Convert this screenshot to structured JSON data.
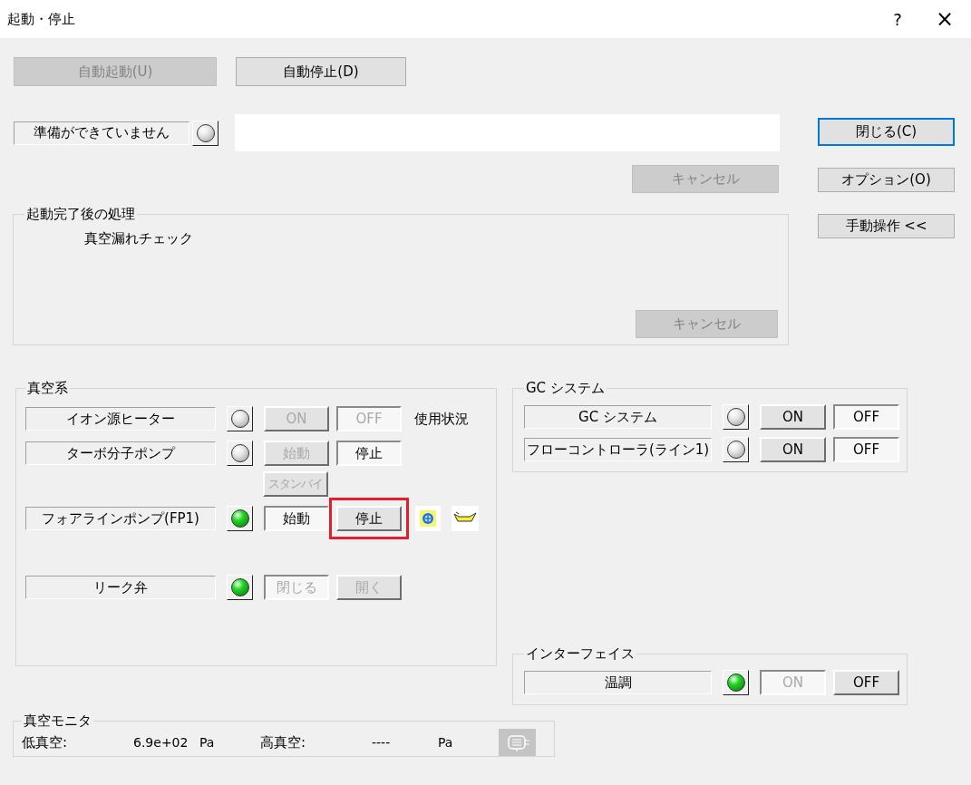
{
  "window": {
    "title": "起動・停止",
    "help": "?",
    "close": "×"
  },
  "auto_buttons": [
    {
      "label": "自動起動(U)",
      "disabled": true
    },
    {
      "label": "自動停止(D)",
      "disabled": false
    }
  ],
  "status": {
    "label": "準備ができていません",
    "lamp_on": false
  },
  "cancel_button": {
    "label": "キャンセル",
    "disabled": true
  },
  "side_buttons": [
    {
      "label": "閉じる(C)",
      "default": true
    },
    {
      "label": "オプション(O)",
      "default": false
    },
    {
      "label": "手動操作 <<",
      "default": false
    }
  ],
  "post_start": {
    "title": "起動完了後の処理",
    "task": "真空漏れチェック",
    "cancel_button": {
      "label": "キャンセル",
      "disabled": true
    }
  },
  "vacuum": {
    "title": "真空系",
    "rows": [
      {
        "name": "イオン源ヒーター",
        "lamp_on": false,
        "buttons": [
          {
            "label": "ON",
            "disabled": true,
            "pressed": false
          },
          {
            "label": "OFF",
            "disabled": true,
            "pressed": true
          }
        ],
        "note": "使用状況"
      },
      {
        "name": "ターボ分子ポンプ",
        "lamp_on": false,
        "buttons": [
          {
            "label": "始動",
            "disabled": true,
            "pressed": false
          },
          {
            "label": "停止",
            "disabled": false,
            "pressed": true
          }
        ],
        "sub_buttons": [
          {
            "label": "スタンバイ",
            "disabled": true,
            "pressed": false
          }
        ]
      },
      {
        "name": "フォアラインポンプ(FP1)",
        "lamp_on": true,
        "buttons": [
          {
            "label": "始動",
            "disabled": false,
            "pressed": true
          },
          {
            "label": "停止",
            "disabled": false,
            "pressed": false,
            "highlighted": true
          }
        ],
        "tool_icons": true
      },
      {
        "name": "リーク弁",
        "lamp_on": true,
        "buttons": [
          {
            "label": "閉じる",
            "disabled": true,
            "pressed": true
          },
          {
            "label": "開く",
            "disabled": true,
            "pressed": false
          }
        ]
      }
    ]
  },
  "gc": {
    "title": "GC システム",
    "rows": [
      {
        "name": "GC システム",
        "lamp_on": false,
        "buttons": [
          {
            "label": "ON",
            "disabled": false,
            "pressed": false
          },
          {
            "label": "OFF",
            "disabled": false,
            "pressed": true
          }
        ]
      },
      {
        "name": "フローコントローラ(ライン1)",
        "lamp_on": false,
        "buttons": [
          {
            "label": "ON",
            "disabled": false,
            "pressed": false
          },
          {
            "label": "OFF",
            "disabled": false,
            "pressed": true
          }
        ]
      }
    ]
  },
  "interface": {
    "title": "インターフェイス",
    "rows": [
      {
        "name": "温調",
        "lamp_on": true,
        "buttons": [
          {
            "label": "ON",
            "disabled": true,
            "pressed": true
          },
          {
            "label": "OFF",
            "disabled": false,
            "pressed": false
          }
        ]
      }
    ]
  },
  "monitor": {
    "title": "真空モニタ",
    "readings": [
      {
        "label": "低真空:",
        "value": "6.9e+02",
        "unit": "Pa"
      },
      {
        "label": "高真空:",
        "value": "----",
        "unit": "Pa"
      }
    ]
  }
}
